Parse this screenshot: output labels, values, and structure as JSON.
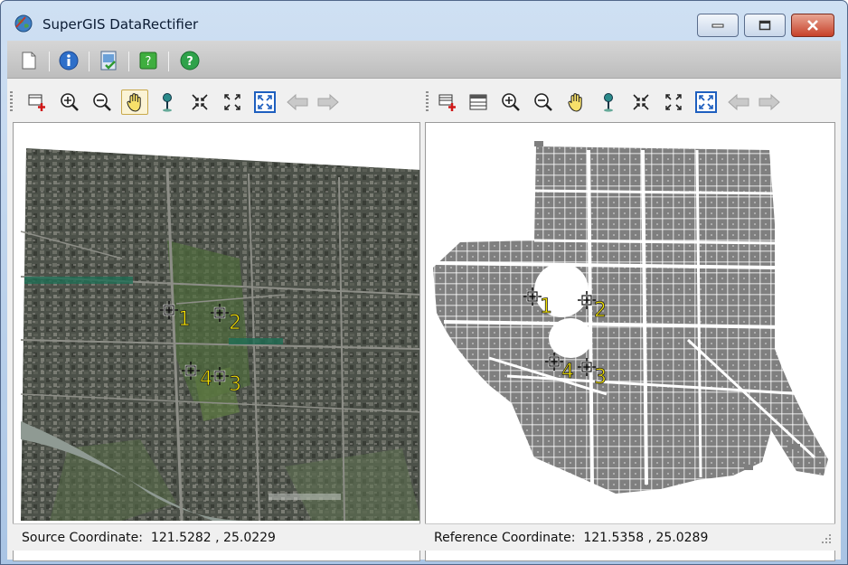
{
  "window": {
    "title": "SuperGIS DataRectifier",
    "controls": {
      "minimize": "minimize",
      "maximize": "maximize",
      "close": "close"
    }
  },
  "main_toolbar": {
    "items": [
      {
        "icon": "new-document-icon"
      },
      {
        "icon": "info-icon"
      },
      {
        "icon": "rectify-image-icon"
      },
      {
        "icon": "report-icon"
      },
      {
        "icon": "help-icon"
      }
    ]
  },
  "source_panel": {
    "tools": [
      "add-control-point-icon",
      "zoom-in-icon",
      "zoom-out-icon",
      "pan-hand-icon",
      "select-point-icon",
      "zoom-fixed-in-icon",
      "zoom-fixed-out-icon",
      "full-extent-icon",
      "back-arrow-icon",
      "forward-arrow-icon"
    ],
    "active_tool": "pan-hand-icon",
    "control_points": [
      {
        "label": "1"
      },
      {
        "label": "2"
      },
      {
        "label": "3"
      },
      {
        "label": "4"
      }
    ],
    "status_label": "Source Coordinate:",
    "coordinate": "121.5282 , 25.0229"
  },
  "reference_panel": {
    "tools": [
      "add-control-point-icon",
      "layer-table-icon",
      "zoom-in-icon",
      "zoom-out-icon",
      "pan-hand-icon",
      "select-point-icon",
      "zoom-fixed-in-icon",
      "zoom-fixed-out-icon",
      "full-extent-icon",
      "back-arrow-icon",
      "forward-arrow-icon"
    ],
    "control_points": [
      {
        "label": "1"
      },
      {
        "label": "2"
      },
      {
        "label": "3"
      },
      {
        "label": "4"
      }
    ],
    "status_label": "Reference Coordinate:",
    "coordinate": "121.5358 , 25.0289"
  },
  "colors": {
    "point_label": "#f7e600",
    "map_gray": "#7f7f7f",
    "imagery_base": "#4a4f45"
  }
}
